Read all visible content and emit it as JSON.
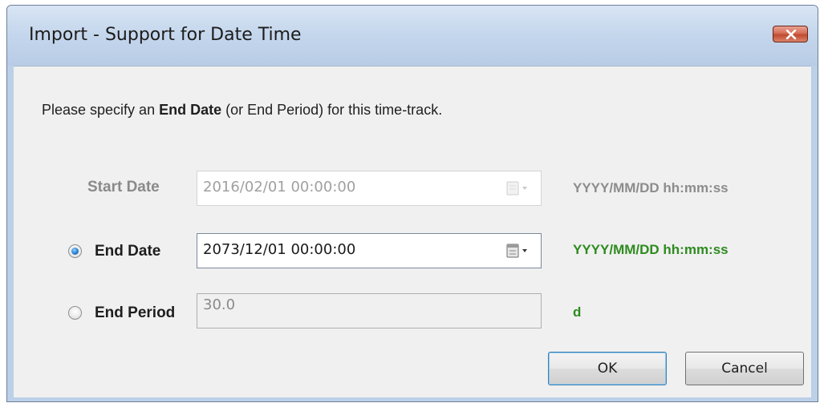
{
  "window": {
    "title": "Import - Support for Date Time"
  },
  "instruction": {
    "prefix": "Please specify an ",
    "bold": "End Date",
    "suffix": " (or End Period) for this time-track."
  },
  "start_date": {
    "label": "Start Date",
    "value": "2016/02/01 00:00:00",
    "format_hint": "YYYY/MM/DD hh:mm:ss",
    "enabled": false
  },
  "end_date": {
    "label": "End Date",
    "value": "2073/12/01 00:00:00",
    "format_hint": "YYYY/MM/DD hh:mm:ss",
    "selected": true
  },
  "end_period": {
    "label": "End Period",
    "value": "30.0",
    "unit": "d",
    "selected": false
  },
  "buttons": {
    "ok": "OK",
    "cancel": "Cancel"
  },
  "colors": {
    "hint_active": "#2e8b1f",
    "hint_disabled": "#8c8c8c",
    "close_button": "#c94c33"
  },
  "icons": {
    "close": "close-icon",
    "calendar": "calendar-dropdown-icon"
  }
}
